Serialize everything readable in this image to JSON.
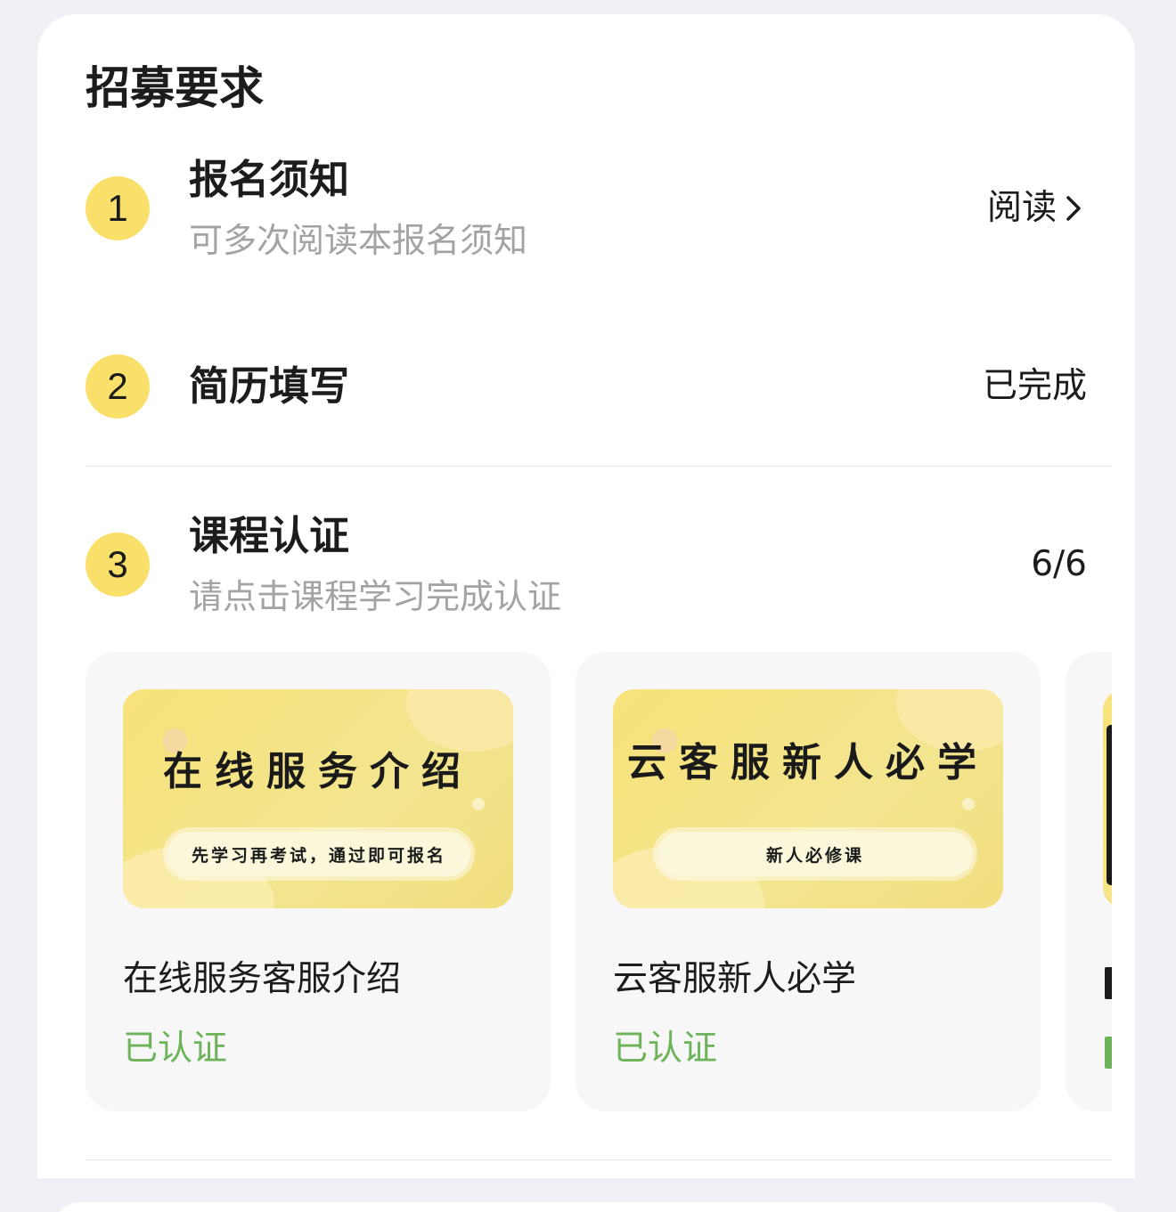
{
  "section_title": "招募要求",
  "steps": [
    {
      "number": "1",
      "title": "报名须知",
      "subtitle": "可多次阅读本报名须知",
      "action": "阅读"
    },
    {
      "number": "2",
      "title": "简历填写",
      "status": "已完成"
    },
    {
      "number": "3",
      "title": "课程认证",
      "subtitle": "请点击课程学习完成认证",
      "progress": "6/6"
    }
  ],
  "courses": [
    {
      "thumb_title": "在线服务介绍",
      "thumb_pill": "先学习再考试，通过即可报名",
      "name": "在线服务客服介绍",
      "status": "已认证"
    },
    {
      "thumb_title": "云客服新人必学",
      "thumb_pill": "新人必修课",
      "name": "云客服新人必学",
      "status": "已认证"
    },
    {
      "thumb_title": "",
      "thumb_pill": "",
      "name": "",
      "status": ""
    }
  ],
  "colors": {
    "badge": "#f9e06b",
    "verified": "#6cb35a",
    "thumb_bg": "#f7e27a",
    "page_bg": "#f0f1f6"
  },
  "icons": {
    "read_arrow": "chevron-right-icon"
  }
}
